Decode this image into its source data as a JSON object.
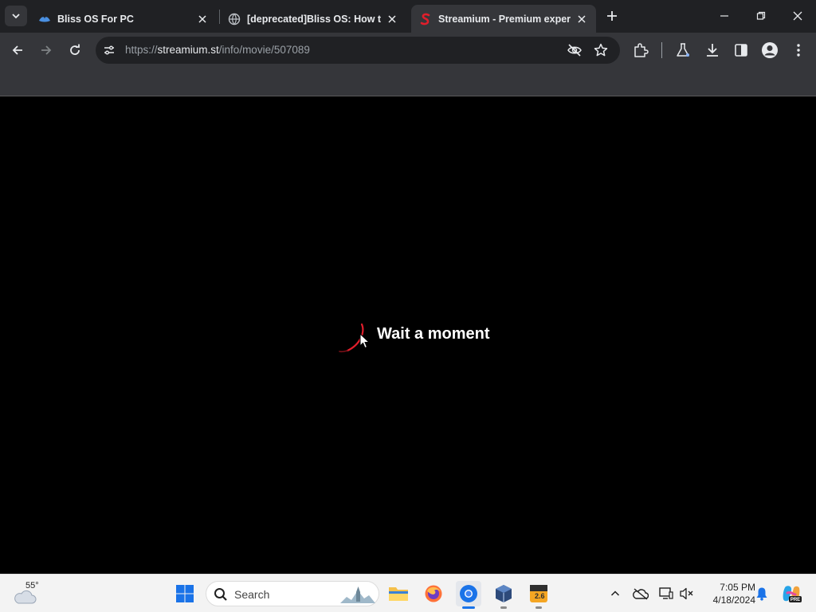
{
  "tabs": [
    {
      "title": "Bliss OS For PC",
      "favicon": "bliss-logo-icon",
      "active": false
    },
    {
      "title": "[deprecated]Bliss OS: How to install",
      "favicon": "globe-icon",
      "active": false
    },
    {
      "title": "Streamium - Premium experience",
      "favicon": "streamium-s-icon",
      "active": true
    }
  ],
  "address_bar": {
    "scheme": "https://",
    "host": "streamium.st",
    "path": "/info/movie/507089"
  },
  "page": {
    "loading_text": "Wait a moment",
    "accent_color": "#e01e2b",
    "background": "#000000"
  },
  "taskbar": {
    "weather_temp": "55°",
    "search_placeholder": "Search",
    "virtualbox_badge": "2.6",
    "clock_time": "7:05 PM",
    "clock_date": "4/18/2024",
    "pinned_apps": [
      "windows-start-icon",
      "file-explorer-icon",
      "firefox-icon",
      "chrome-icon",
      "virtualbox-icon",
      "app-badge-icon"
    ]
  }
}
